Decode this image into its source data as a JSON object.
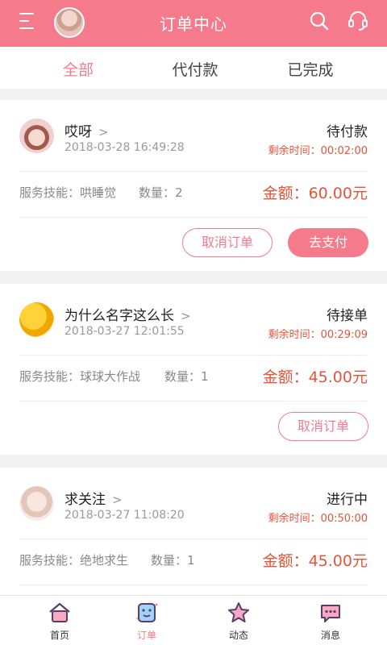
{
  "header": {
    "title": "订单中心"
  },
  "tabs": [
    {
      "label": "全部",
      "active": true
    },
    {
      "label": "代付款",
      "active": false
    },
    {
      "label": "已完成",
      "active": false
    }
  ],
  "orders": [
    {
      "name": "哎呀",
      "time": "2018-03-28   16:49:28",
      "status": "待付款",
      "remaining": "剩余时间：00:02:00",
      "skill": "服务技能：哄睡觉",
      "quantity": "数量：2",
      "amount": "金额：60.00元",
      "cancel_label": "取消订单",
      "pay_label": "去支付"
    },
    {
      "name": "为什么名字这么长",
      "time": "2018-03-27   12:01:55",
      "status": "待接单",
      "remaining": "剩余时间：00:29:09",
      "skill": "服务技能：球球大作战",
      "quantity": "数量：1",
      "amount": "金额：45.00元",
      "cancel_label": "取消订单"
    },
    {
      "name": "求关注",
      "time": "2018-03-27   11:08:20",
      "status": "进行中",
      "remaining": "剩余时间：00:50:00",
      "skill": "服务技能：绝地求生",
      "quantity": "数量：1",
      "amount": "金额：45.00元"
    }
  ],
  "bottom_nav": [
    {
      "label": "首页",
      "icon": "home-icon",
      "active": false
    },
    {
      "label": "订单",
      "icon": "order-icon",
      "active": true
    },
    {
      "label": "动态",
      "icon": "star-icon",
      "active": false
    },
    {
      "label": "消息",
      "icon": "message-icon",
      "active": false
    }
  ],
  "colors": {
    "accent": "#f57a8b",
    "price": "#e3553b"
  }
}
